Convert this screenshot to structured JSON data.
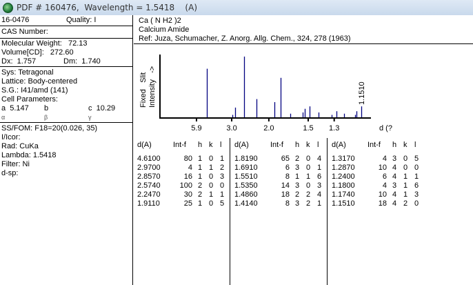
{
  "window": {
    "title": "PDF # 160476,  Wavelength = 1.5418    (A)"
  },
  "left": {
    "pdf_number": "16-0476",
    "quality": "Quality: I",
    "cas": "CAS Number:",
    "mw": "Molecular Weight:   72.13",
    "volume": "Volume[CD]:   272.60",
    "dx": "Dx:  1.757",
    "dm": "Dm:  1.740",
    "sys": "Sys: Tetragonal",
    "lattice": "Lattice: Body-centered",
    "sg": "S.G.: I41/amd (141)",
    "cell": "Cell Parameters:",
    "a": "a  5.147",
    "b": "b",
    "c": "c  10.29",
    "alpha": "α",
    "beta": "β",
    "gamma": "γ",
    "ssfom": "SS/FOM: F18=20(0.026, 35)",
    "icor": "I/Icor:",
    "rad": "Rad: CuKa",
    "lambda": "Lambda: 1.5418",
    "filter": "Filter: Ni",
    "dsp": "d-sp:"
  },
  "header": {
    "formula": "Ca ( N H2 )2",
    "name": "Calcium Amide",
    "ref": "Ref: Juza, Schumacher, Z. Anorg. Allg. Chem., 324, 278 (1963)"
  },
  "chart_data": {
    "type": "bar",
    "ylabel_1": "Fixed   Slit",
    "ylabel_2": "Intensity   ->",
    "xlabel": "d (?",
    "wavelength": 1.5418,
    "x_ticks": [
      "5.9",
      "3.0",
      "2.0",
      "1.5",
      "1.3"
    ],
    "x_tick_values": [
      5.9,
      3.0,
      2.0,
      1.5,
      1.3
    ],
    "annotation": "1.1510",
    "d": [
      4.61,
      2.97,
      2.857,
      2.574,
      2.247,
      1.911,
      1.819,
      1.691,
      1.551,
      1.535,
      1.486,
      1.414,
      1.317,
      1.287,
      1.24,
      1.18,
      1.174,
      1.151
    ],
    "intensity": [
      80,
      4,
      16,
      100,
      30,
      25,
      65,
      6,
      8,
      14,
      18,
      8,
      4,
      10,
      6,
      4,
      10,
      18
    ],
    "twotheta_range": [
      0,
      89
    ],
    "color": "#000080"
  },
  "table": {
    "headers": [
      "d(A)",
      "Int-f",
      "h",
      "k",
      "l"
    ],
    "columns": [
      [
        [
          "4.6100",
          "80",
          "1",
          "0",
          "1"
        ],
        [
          "2.9700",
          "4",
          "1",
          "1",
          "2"
        ],
        [
          "2.8570",
          "16",
          "1",
          "0",
          "3"
        ],
        [
          "2.5740",
          "100",
          "2",
          "0",
          "0"
        ],
        [
          "2.2470",
          "30",
          "2",
          "1",
          "1"
        ],
        [
          "1.9110",
          "25",
          "1",
          "0",
          "5"
        ]
      ],
      [
        [
          "1.8190",
          "65",
          "2",
          "0",
          "4"
        ],
        [
          "1.6910",
          "6",
          "3",
          "0",
          "1"
        ],
        [
          "1.5510",
          "8",
          "1",
          "1",
          "6"
        ],
        [
          "1.5350",
          "14",
          "3",
          "0",
          "3"
        ],
        [
          "1.4860",
          "18",
          "2",
          "2",
          "4"
        ],
        [
          "1.4140",
          "8",
          "3",
          "2",
          "1"
        ]
      ],
      [
        [
          "1.3170",
          "4",
          "3",
          "0",
          "5"
        ],
        [
          "1.2870",
          "10",
          "4",
          "0",
          "0"
        ],
        [
          "1.2400",
          "6",
          "4",
          "1",
          "1"
        ],
        [
          "1.1800",
          "4",
          "3",
          "1",
          "6"
        ],
        [
          "1.1740",
          "10",
          "4",
          "1",
          "3"
        ],
        [
          "1.1510",
          "18",
          "4",
          "2",
          "0"
        ]
      ]
    ]
  }
}
